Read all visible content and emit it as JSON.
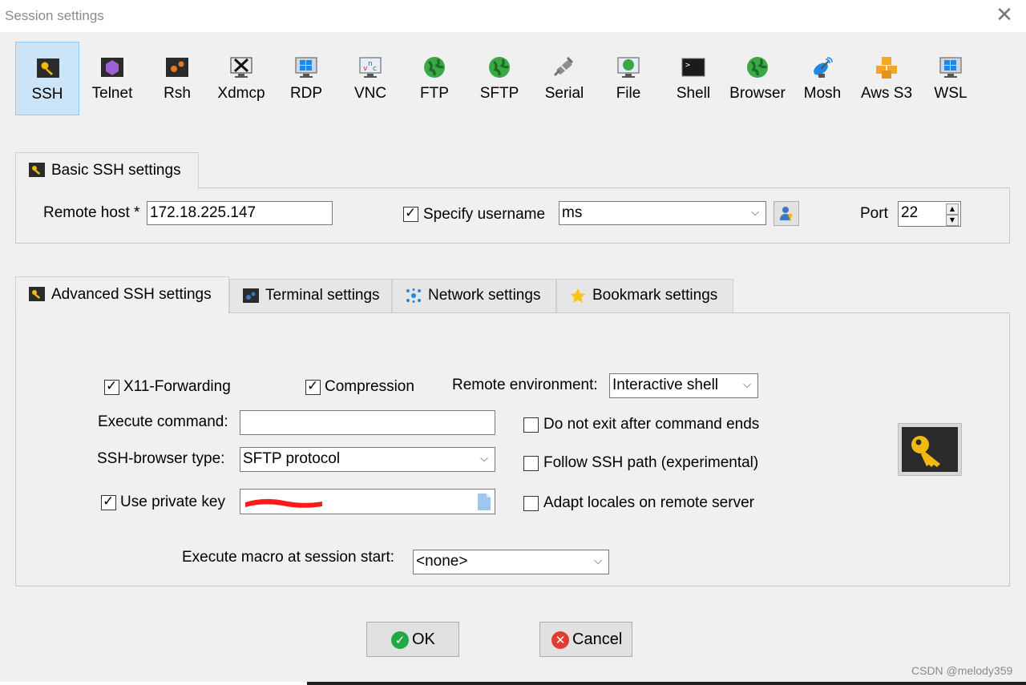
{
  "window": {
    "title": "Session settings"
  },
  "session_types": [
    {
      "label": "SSH",
      "icon": "key-icon",
      "selected": true
    },
    {
      "label": "Telnet",
      "icon": "telnet-icon",
      "selected": false
    },
    {
      "label": "Rsh",
      "icon": "rsh-icon",
      "selected": false
    },
    {
      "label": "Xdmcp",
      "icon": "xdmcp-icon",
      "selected": false
    },
    {
      "label": "RDP",
      "icon": "rdp-icon",
      "selected": false
    },
    {
      "label": "VNC",
      "icon": "vnc-icon",
      "selected": false
    },
    {
      "label": "FTP",
      "icon": "globe-icon",
      "selected": false
    },
    {
      "label": "SFTP",
      "icon": "globe-icon",
      "selected": false
    },
    {
      "label": "Serial",
      "icon": "plug-icon",
      "selected": false
    },
    {
      "label": "File",
      "icon": "file-monitor-icon",
      "selected": false
    },
    {
      "label": "Shell",
      "icon": "terminal-icon",
      "selected": false
    },
    {
      "label": "Browser",
      "icon": "globe-icon",
      "selected": false
    },
    {
      "label": "Mosh",
      "icon": "satellite-icon",
      "selected": false
    },
    {
      "label": "Aws S3",
      "icon": "cubes-icon",
      "selected": false
    },
    {
      "label": "WSL",
      "icon": "windows-icon",
      "selected": false
    }
  ],
  "basic": {
    "tab_label": "Basic SSH settings",
    "remote_host_label": "Remote host *",
    "remote_host_value": "172.18.225.147",
    "specify_username_label": "Specify username",
    "specify_username_checked": true,
    "username_value": "ms",
    "port_label": "Port",
    "port_value": "22"
  },
  "tabs": [
    {
      "label": "Advanced SSH settings",
      "icon": "key-icon",
      "active": true
    },
    {
      "label": "Terminal settings",
      "icon": "terminal-settings-icon",
      "active": false
    },
    {
      "label": "Network settings",
      "icon": "network-icon",
      "active": false
    },
    {
      "label": "Bookmark settings",
      "icon": "star-icon",
      "active": false
    }
  ],
  "advanced": {
    "x11_label": "X11-Forwarding",
    "x11_checked": true,
    "compression_label": "Compression",
    "compression_checked": true,
    "remote_env_label": "Remote environment:",
    "remote_env_value": "Interactive shell",
    "exec_cmd_label": "Execute command:",
    "exec_cmd_value": "",
    "ssh_browser_label": "SSH-browser type:",
    "ssh_browser_value": "SFTP protocol",
    "private_key_label": "Use private key",
    "private_key_checked": true,
    "private_key_value": "",
    "no_exit_label": "Do not exit after command ends",
    "no_exit_checked": false,
    "follow_path_label": "Follow SSH path (experimental)",
    "follow_path_checked": false,
    "adapt_locales_label": "Adapt locales on remote server",
    "adapt_locales_checked": false,
    "macro_label": "Execute macro at session start:",
    "macro_value": "<none>"
  },
  "buttons": {
    "ok": "OK",
    "cancel": "Cancel"
  },
  "watermark": "CSDN @melody359",
  "colors": {
    "selected_bg": "#cce4f7",
    "ok_green": "#22a845",
    "cancel_red": "#e03c31",
    "key_gold": "#f2b90f"
  }
}
